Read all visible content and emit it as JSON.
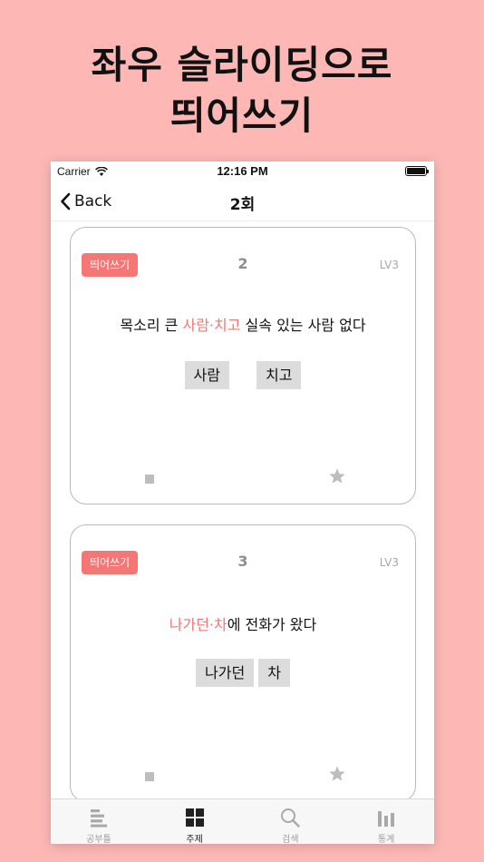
{
  "headline": {
    "line1": "좌우 슬라이딩으로",
    "line2": "띄어쓰기"
  },
  "statusbar": {
    "carrier": "Carrier",
    "time": "12:16 PM"
  },
  "navbar": {
    "back_label": "Back",
    "title": "2회"
  },
  "cards": [
    {
      "tag": "띄어쓰기",
      "number": "2",
      "level": "LV3",
      "sentence_pre": "목소리 큰 ",
      "sentence_highlight": "사람·치고",
      "sentence_post": " 실속 있는 사람 없다",
      "chips": [
        "사람",
        "치고"
      ]
    },
    {
      "tag": "띄어쓰기",
      "number": "3",
      "level": "LV3",
      "sentence_pre": "",
      "sentence_highlight": "나가던·차",
      "sentence_post": "에 전화가 왔다",
      "chips": [
        "나가던",
        "차"
      ]
    }
  ],
  "tabbar": {
    "items": [
      {
        "label": "공부틀",
        "icon": "list-bars-icon",
        "active": false
      },
      {
        "label": "주제",
        "icon": "grid-icon",
        "active": true
      },
      {
        "label": "검색",
        "icon": "search-icon",
        "active": false
      },
      {
        "label": "통계",
        "icon": "bar-chart-icon",
        "active": false
      }
    ]
  },
  "colors": {
    "background": "#fdb8b6",
    "accent": "#f47675",
    "chip": "#dcdcdc"
  }
}
